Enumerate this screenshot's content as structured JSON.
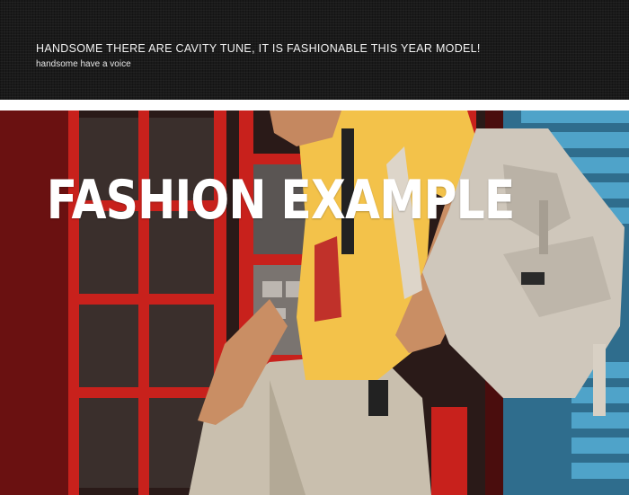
{
  "header": {
    "headline": "HANDSOME THERE ARE CAVITY TUNE, IT IS FASHIONABLE THIS YEAR MODEL!",
    "subline": "handsome have a voice"
  },
  "banner": {
    "title": "FASHION EXAMPLE"
  },
  "colors": {
    "header_bg": "#1a1a1a",
    "phone_booth_red": "#c8211c",
    "shirt_yellow": "#f3c24a",
    "backpack_beige": "#cfc7bb",
    "building_blue": "#3f8fb8"
  }
}
